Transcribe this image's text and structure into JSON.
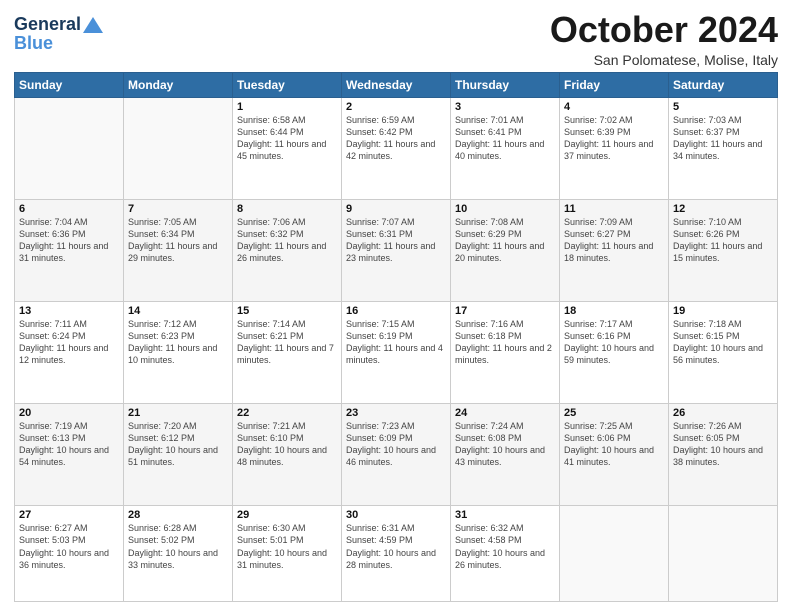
{
  "header": {
    "logo_line1": "General",
    "logo_line2": "Blue",
    "month_title": "October 2024",
    "subtitle": "San Polomatese, Molise, Italy"
  },
  "days_of_week": [
    "Sunday",
    "Monday",
    "Tuesday",
    "Wednesday",
    "Thursday",
    "Friday",
    "Saturday"
  ],
  "weeks": [
    [
      {
        "day": "",
        "info": ""
      },
      {
        "day": "",
        "info": ""
      },
      {
        "day": "1",
        "info": "Sunrise: 6:58 AM\nSunset: 6:44 PM\nDaylight: 11 hours and 45 minutes."
      },
      {
        "day": "2",
        "info": "Sunrise: 6:59 AM\nSunset: 6:42 PM\nDaylight: 11 hours and 42 minutes."
      },
      {
        "day": "3",
        "info": "Sunrise: 7:01 AM\nSunset: 6:41 PM\nDaylight: 11 hours and 40 minutes."
      },
      {
        "day": "4",
        "info": "Sunrise: 7:02 AM\nSunset: 6:39 PM\nDaylight: 11 hours and 37 minutes."
      },
      {
        "day": "5",
        "info": "Sunrise: 7:03 AM\nSunset: 6:37 PM\nDaylight: 11 hours and 34 minutes."
      }
    ],
    [
      {
        "day": "6",
        "info": "Sunrise: 7:04 AM\nSunset: 6:36 PM\nDaylight: 11 hours and 31 minutes."
      },
      {
        "day": "7",
        "info": "Sunrise: 7:05 AM\nSunset: 6:34 PM\nDaylight: 11 hours and 29 minutes."
      },
      {
        "day": "8",
        "info": "Sunrise: 7:06 AM\nSunset: 6:32 PM\nDaylight: 11 hours and 26 minutes."
      },
      {
        "day": "9",
        "info": "Sunrise: 7:07 AM\nSunset: 6:31 PM\nDaylight: 11 hours and 23 minutes."
      },
      {
        "day": "10",
        "info": "Sunrise: 7:08 AM\nSunset: 6:29 PM\nDaylight: 11 hours and 20 minutes."
      },
      {
        "day": "11",
        "info": "Sunrise: 7:09 AM\nSunset: 6:27 PM\nDaylight: 11 hours and 18 minutes."
      },
      {
        "day": "12",
        "info": "Sunrise: 7:10 AM\nSunset: 6:26 PM\nDaylight: 11 hours and 15 minutes."
      }
    ],
    [
      {
        "day": "13",
        "info": "Sunrise: 7:11 AM\nSunset: 6:24 PM\nDaylight: 11 hours and 12 minutes."
      },
      {
        "day": "14",
        "info": "Sunrise: 7:12 AM\nSunset: 6:23 PM\nDaylight: 11 hours and 10 minutes."
      },
      {
        "day": "15",
        "info": "Sunrise: 7:14 AM\nSunset: 6:21 PM\nDaylight: 11 hours and 7 minutes."
      },
      {
        "day": "16",
        "info": "Sunrise: 7:15 AM\nSunset: 6:19 PM\nDaylight: 11 hours and 4 minutes."
      },
      {
        "day": "17",
        "info": "Sunrise: 7:16 AM\nSunset: 6:18 PM\nDaylight: 11 hours and 2 minutes."
      },
      {
        "day": "18",
        "info": "Sunrise: 7:17 AM\nSunset: 6:16 PM\nDaylight: 10 hours and 59 minutes."
      },
      {
        "day": "19",
        "info": "Sunrise: 7:18 AM\nSunset: 6:15 PM\nDaylight: 10 hours and 56 minutes."
      }
    ],
    [
      {
        "day": "20",
        "info": "Sunrise: 7:19 AM\nSunset: 6:13 PM\nDaylight: 10 hours and 54 minutes."
      },
      {
        "day": "21",
        "info": "Sunrise: 7:20 AM\nSunset: 6:12 PM\nDaylight: 10 hours and 51 minutes."
      },
      {
        "day": "22",
        "info": "Sunrise: 7:21 AM\nSunset: 6:10 PM\nDaylight: 10 hours and 48 minutes."
      },
      {
        "day": "23",
        "info": "Sunrise: 7:23 AM\nSunset: 6:09 PM\nDaylight: 10 hours and 46 minutes."
      },
      {
        "day": "24",
        "info": "Sunrise: 7:24 AM\nSunset: 6:08 PM\nDaylight: 10 hours and 43 minutes."
      },
      {
        "day": "25",
        "info": "Sunrise: 7:25 AM\nSunset: 6:06 PM\nDaylight: 10 hours and 41 minutes."
      },
      {
        "day": "26",
        "info": "Sunrise: 7:26 AM\nSunset: 6:05 PM\nDaylight: 10 hours and 38 minutes."
      }
    ],
    [
      {
        "day": "27",
        "info": "Sunrise: 6:27 AM\nSunset: 5:03 PM\nDaylight: 10 hours and 36 minutes."
      },
      {
        "day": "28",
        "info": "Sunrise: 6:28 AM\nSunset: 5:02 PM\nDaylight: 10 hours and 33 minutes."
      },
      {
        "day": "29",
        "info": "Sunrise: 6:30 AM\nSunset: 5:01 PM\nDaylight: 10 hours and 31 minutes."
      },
      {
        "day": "30",
        "info": "Sunrise: 6:31 AM\nSunset: 4:59 PM\nDaylight: 10 hours and 28 minutes."
      },
      {
        "day": "31",
        "info": "Sunrise: 6:32 AM\nSunset: 4:58 PM\nDaylight: 10 hours and 26 minutes."
      },
      {
        "day": "",
        "info": ""
      },
      {
        "day": "",
        "info": ""
      }
    ]
  ]
}
